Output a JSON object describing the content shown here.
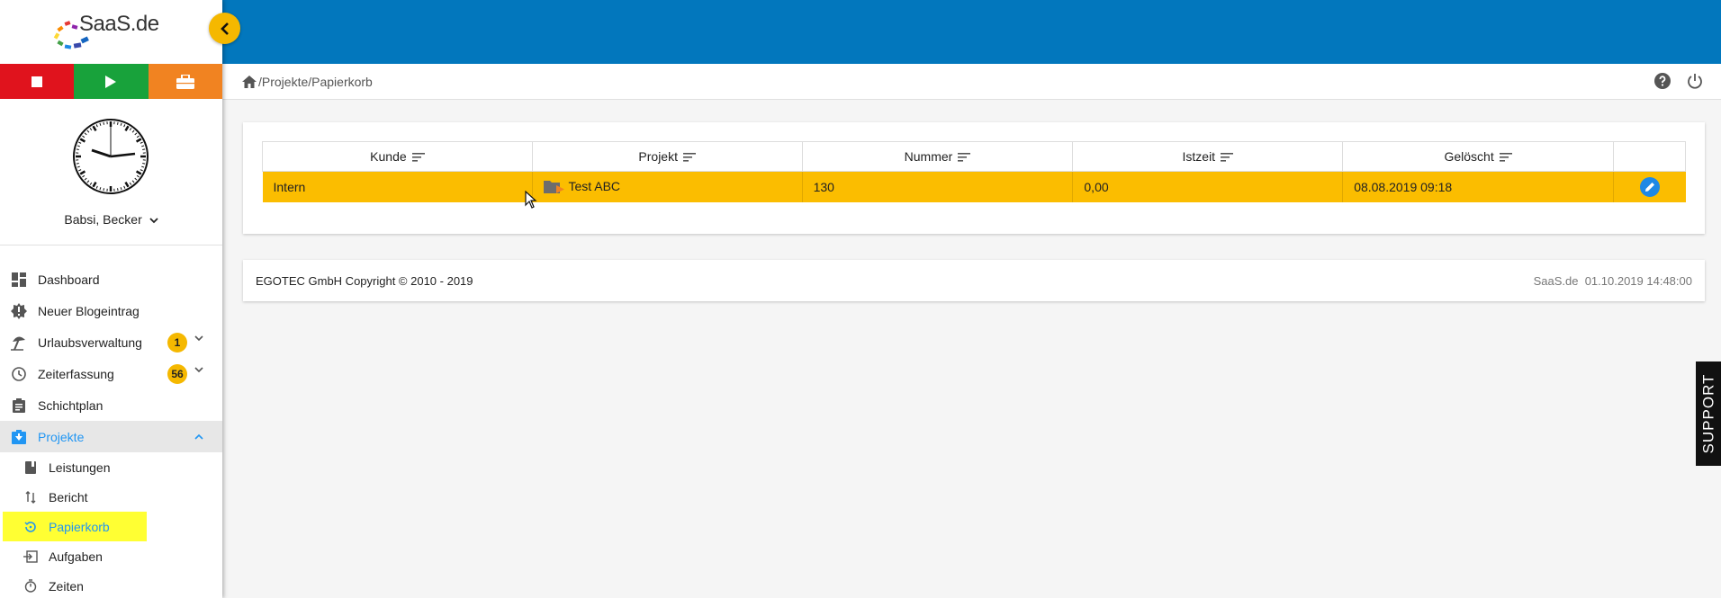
{
  "brand": {
    "logo_text": "SaaS.de"
  },
  "user": {
    "name": "Babsi, Becker"
  },
  "sidebar": {
    "items": [
      {
        "label": "Dashboard",
        "icon": "dashboard-icon"
      },
      {
        "label": "Neuer Blogeintrag",
        "icon": "badge-alert-icon"
      },
      {
        "label": "Urlaubsverwaltung",
        "icon": "beach-umbrella-icon",
        "badge": "1"
      },
      {
        "label": "Zeiterfassung",
        "icon": "clock-icon",
        "badge": "56"
      },
      {
        "label": "Schichtplan",
        "icon": "clipboard-icon"
      },
      {
        "label": "Projekte",
        "icon": "project-icon",
        "active": true
      }
    ],
    "subitems": [
      {
        "label": "Leistungen",
        "icon": "book-icon"
      },
      {
        "label": "Bericht",
        "icon": "swap-vertical-icon"
      },
      {
        "label": "Papierkorb",
        "icon": "restore-icon",
        "highlight": true
      },
      {
        "label": "Aufgaben",
        "icon": "login-box-icon"
      },
      {
        "label": "Zeiten",
        "icon": "timer-icon"
      }
    ]
  },
  "breadcrumb": {
    "sep": "/",
    "path1": "Projekte",
    "path2": "Papierkorb"
  },
  "table": {
    "columns": [
      "Kunde",
      "Projekt",
      "Nummer",
      "Istzeit",
      "Gelöscht"
    ],
    "rows": [
      {
        "kunde": "Intern",
        "projekt": "Test ABC",
        "nummer": "130",
        "istzeit": "0,00",
        "geloescht": "08.08.2019 09:18"
      }
    ]
  },
  "footer": {
    "copyright": "EGOTEC GmbH Copyright © 2010 - 2019",
    "right": "SaaS.de  01.10.2019 14:48:00"
  },
  "support_label": "SUPPORT",
  "colors": {
    "topbar": "#0277bd",
    "row_highlight": "#fbbd00",
    "stop": "#e0131d",
    "play": "#18a23b",
    "case": "#f18321",
    "accent": "#2196f3"
  }
}
